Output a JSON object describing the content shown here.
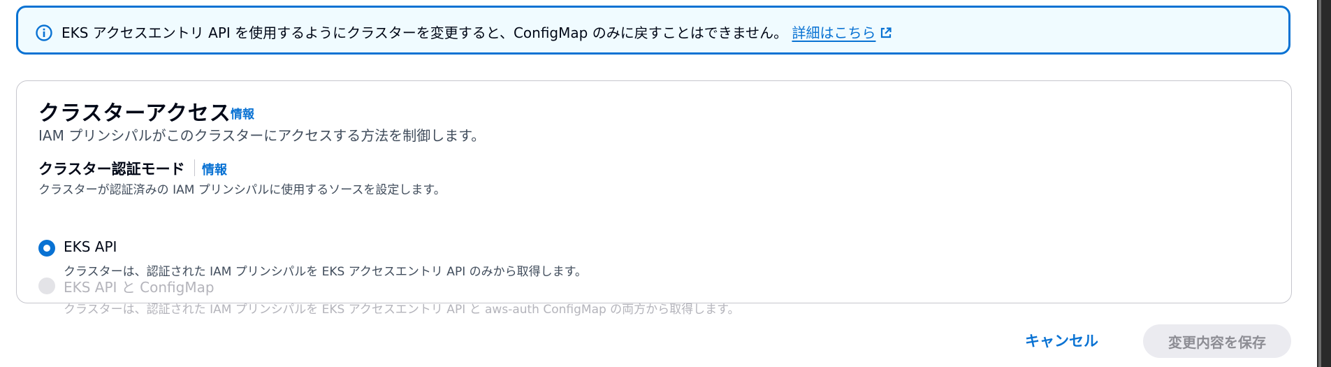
{
  "alert": {
    "message": "EKS アクセスエントリ API を使用するようにクラスターを変更すると、ConfigMap のみに戻すことはできません。",
    "link_label": "詳細はこちら"
  },
  "card": {
    "title": "クラスターアクセス",
    "info_label": "情報",
    "description": "IAM プリンシパルがこのクラスターにアクセスする方法を制御します。",
    "auth_mode": {
      "label": "クラスター認証モード",
      "info_label": "情報",
      "description": "クラスターが認証済みの IAM プリンシパルに使用するソースを設定します。",
      "options": [
        {
          "label": "EKS API",
          "description": "クラスターは、認証された IAM プリンシパルを EKS アクセスエントリ API のみから取得します。",
          "checked": true,
          "disabled": false
        },
        {
          "label": "EKS API と ConfigMap",
          "description": "クラスターは、認証された IAM プリンシパルを EKS アクセスエントリ API と aws-auth ConfigMap の両方から取得します。",
          "checked": false,
          "disabled": true
        }
      ]
    }
  },
  "footer": {
    "cancel_label": "キャンセル",
    "save_label": "変更内容を保存"
  },
  "colors": {
    "accent": "#0972d3",
    "alert_bg": "#f0fbff",
    "disabled_text": "#b4b4bb"
  },
  "icons": [
    "info-circle-icon",
    "external-link-icon"
  ]
}
